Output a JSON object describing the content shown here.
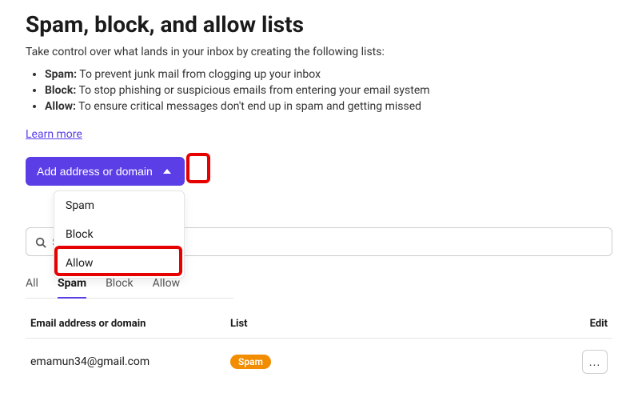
{
  "header": {
    "title": "Spam, block, and allow lists",
    "subtitle": "Take control over what lands in your inbox by creating the following lists:"
  },
  "bullets": [
    {
      "label": "Spam:",
      "text": " To prevent junk mail from clogging up your inbox"
    },
    {
      "label": "Block:",
      "text": " To stop phishing or suspicious emails from entering your email system"
    },
    {
      "label": "Allow:",
      "text": " To ensure critical messages don't end up in spam and getting missed"
    }
  ],
  "learn_more": "Learn more",
  "add_button": {
    "label": "Add address or domain"
  },
  "dropdown": {
    "items": [
      "Spam",
      "Block",
      "Allow"
    ]
  },
  "search": {
    "placeholder": "Search"
  },
  "tabs": [
    {
      "label": "All",
      "active": false
    },
    {
      "label": "Spam",
      "active": true
    },
    {
      "label": "Block",
      "active": false
    },
    {
      "label": "Allow",
      "active": false
    }
  ],
  "table": {
    "columns": {
      "email": "Email address or domain",
      "list": "List",
      "edit": "Edit"
    },
    "rows": [
      {
        "email": "emamun34@gmail.com",
        "list_badge": "Spam",
        "edit": "..."
      }
    ]
  }
}
